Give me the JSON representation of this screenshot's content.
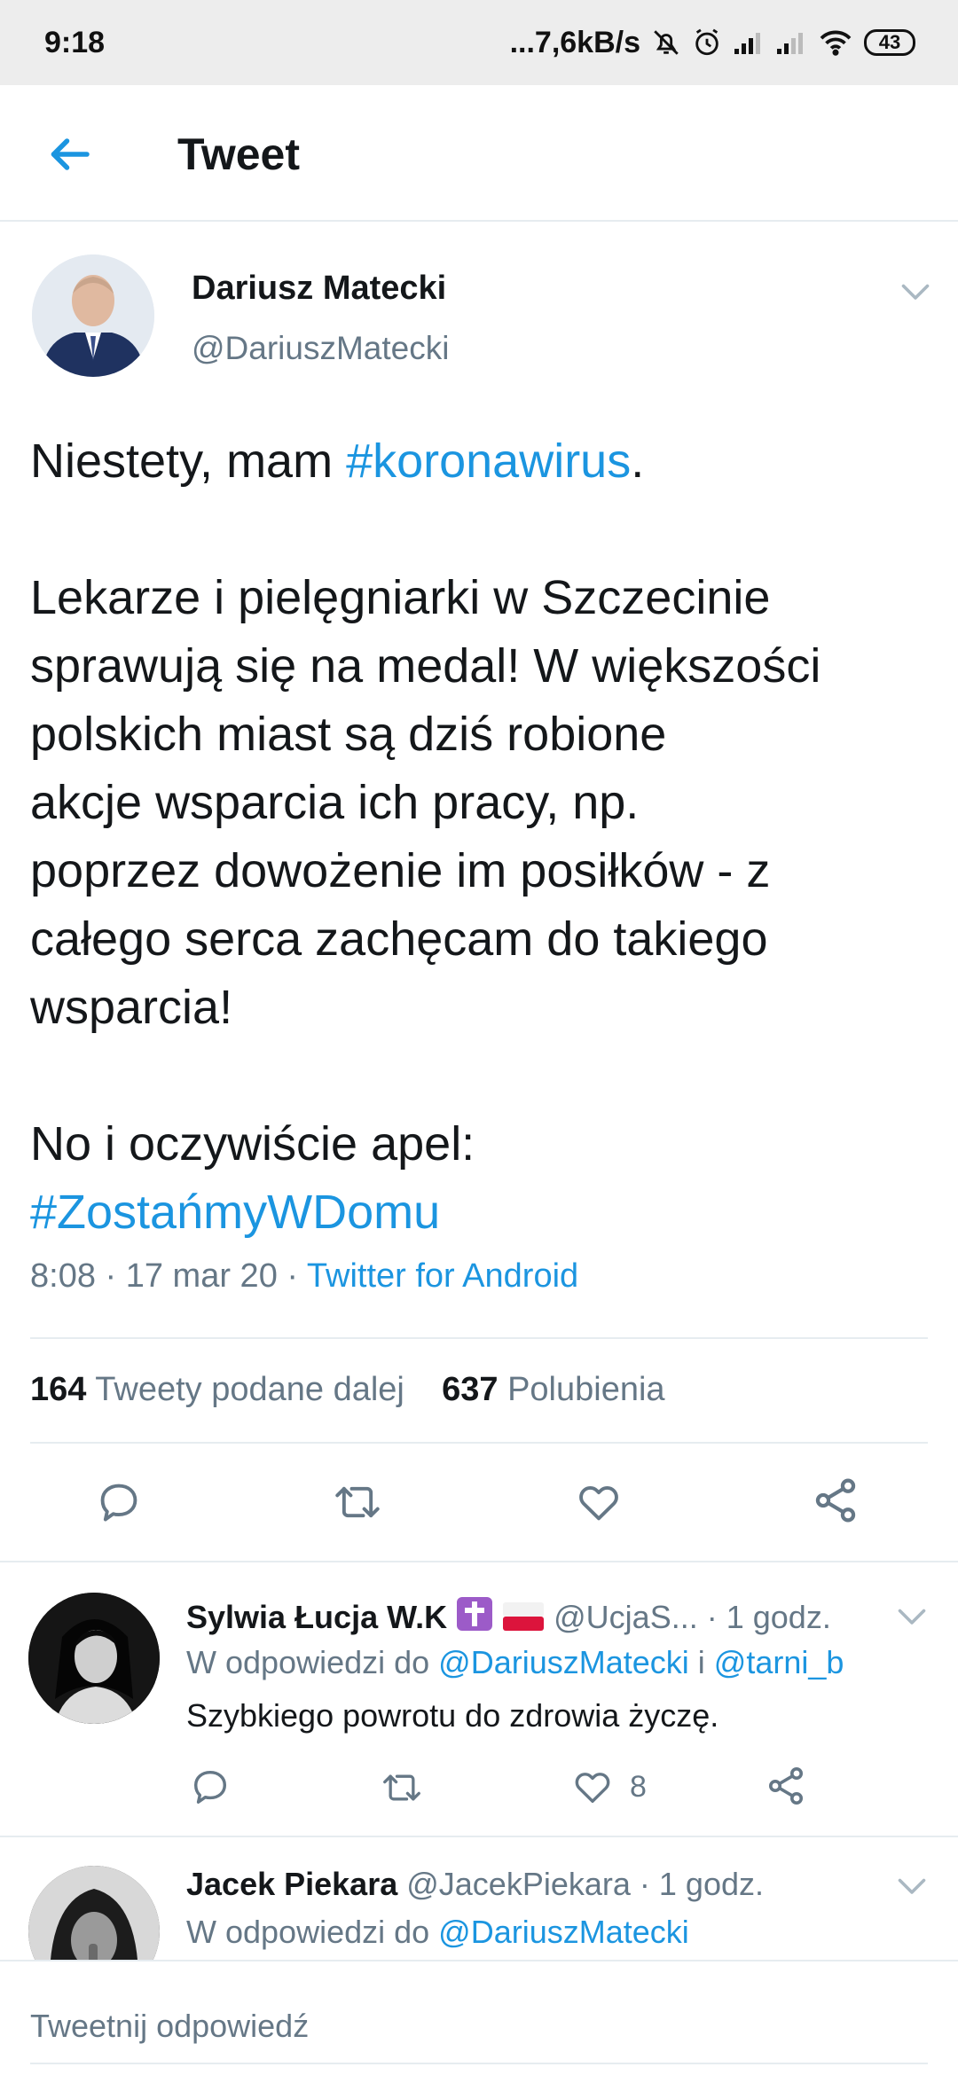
{
  "status_bar": {
    "time": "9:18",
    "network_speed": "...7,6kB/s",
    "battery": "43"
  },
  "header": {
    "title": "Tweet"
  },
  "tweet": {
    "author_name": "Dariusz Matecki",
    "author_handle": "@DariuszMatecki",
    "line1_text": "Niestety, mam ",
    "line1_hashtag": "#koronawirus",
    "line1_end": ".",
    "paragraph2": [
      "Lekarze i pielęgniarki w Szczecinie",
      "sprawują się na medal! W większości",
      "polskich miast są dziś robione",
      "akcje wsparcia ich pracy, np.",
      "poprzez dowożenie im posiłków - z",
      "całego serca zachęcam do takiego",
      "wsparcia!"
    ],
    "appeal": "No i oczywiście apel:",
    "appeal_hashtag": "#ZostańmyWDomu",
    "timestamp": "8:08 · 17 mar 20 · ",
    "source": "Twitter for Android",
    "retweets_count": "164",
    "retweets_label": "Tweety podane dalej",
    "likes_count": "637",
    "likes_label": "Polubienia"
  },
  "replies": [
    {
      "name": "Sylwia Łucja W.K",
      "handle": "@UcjaS...",
      "time": "· 1 godz.",
      "reply_prefix": "W odpowiedzi do ",
      "mention1": "@DariuszMatecki",
      "joiner": " i ",
      "mention2": "@tarni_b",
      "text": "Szybkiego powrotu do zdrowia życzę.",
      "like_count": "8"
    },
    {
      "name": "Jacek Piekara",
      "handle": "@JacekPiekara",
      "time": "· 1 godz.",
      "reply_prefix": "W odpowiedzi do ",
      "mention1": "@DariuszMatecki"
    }
  ],
  "composer": {
    "placeholder": "Tweetnij odpowiedź"
  },
  "icons": {
    "accent": "#1b95e0",
    "back": "arrow-left-icon",
    "reply": "comment-icon",
    "retweet": "retweet-icon",
    "like": "heart-icon",
    "share": "share-icon"
  }
}
